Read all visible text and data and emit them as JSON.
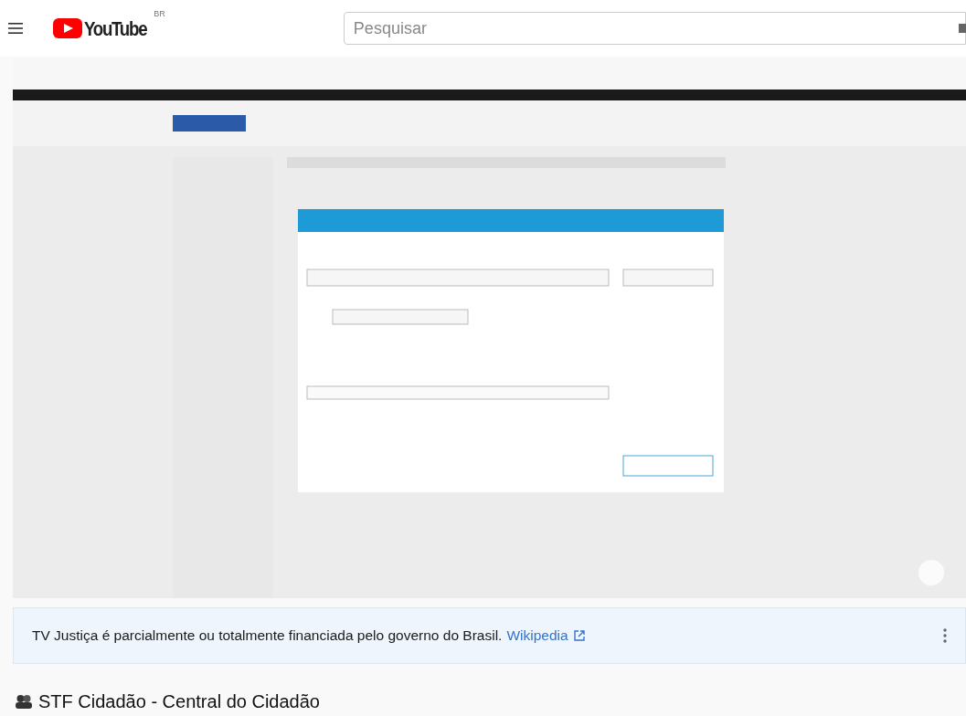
{
  "header": {
    "logo": {
      "text": "YouTube",
      "country": "BR"
    },
    "search": {
      "placeholder": "Pesquisar"
    }
  },
  "info_panel": {
    "text": "TV Justiça é parcialmente ou totalmente financiada pelo governo do Brasil.",
    "link": "Wikipedia"
  },
  "title": "STF Cidadão - Central do Cidadão"
}
